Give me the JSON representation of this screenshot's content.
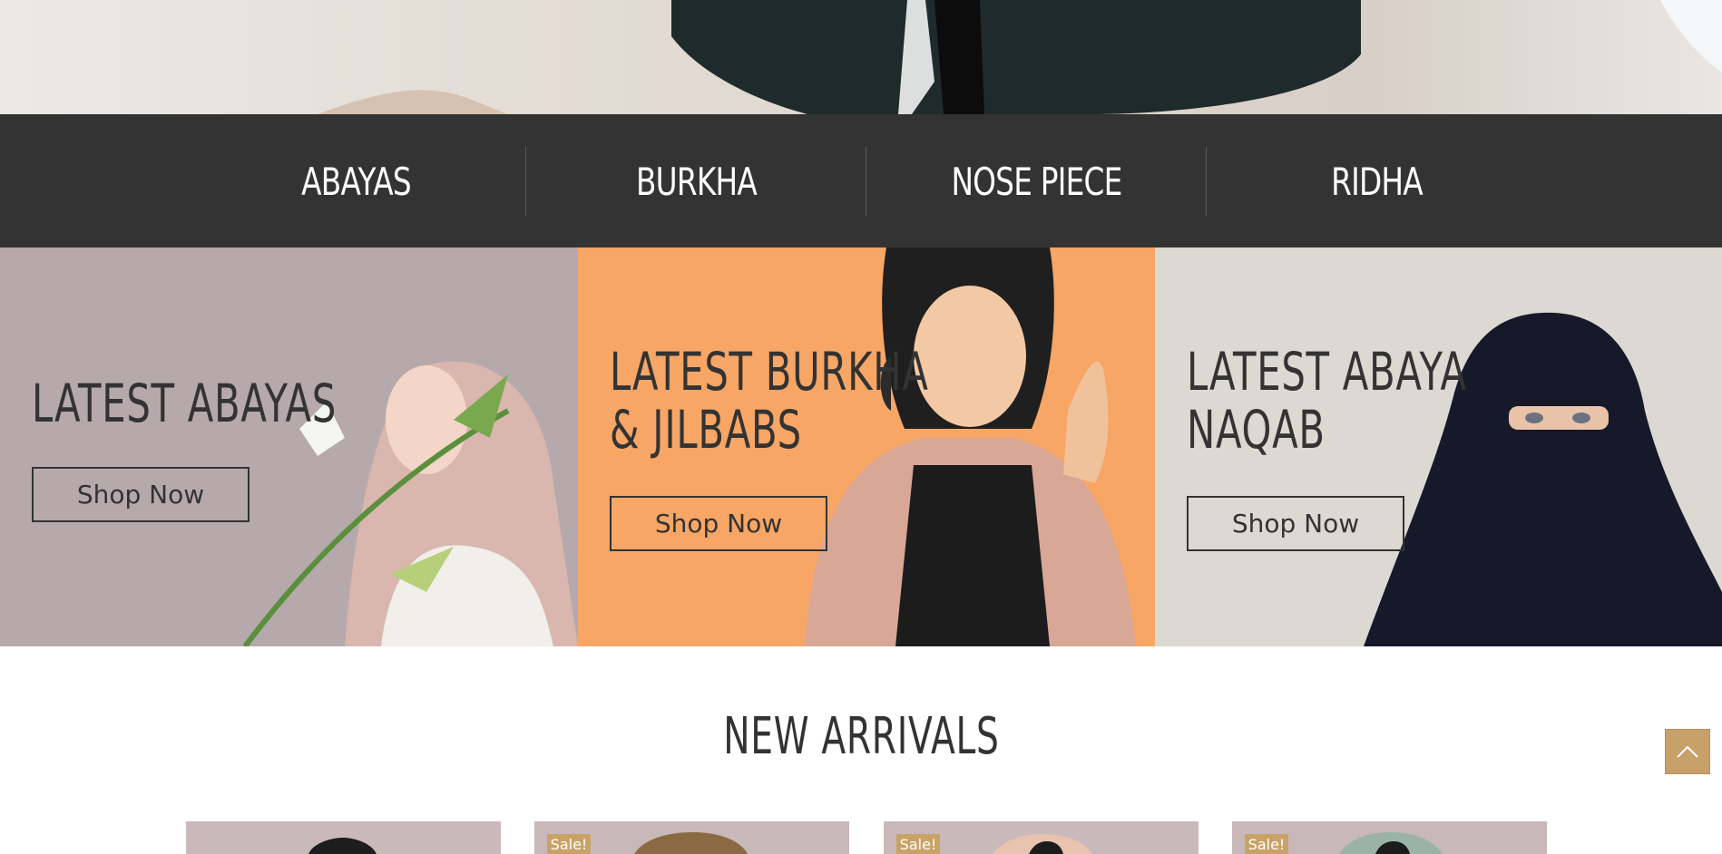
{
  "categories": [
    {
      "label": "ABAYAS"
    },
    {
      "label": "BURKHA"
    },
    {
      "label": "NOSE PIECE"
    },
    {
      "label": "RIDHA"
    }
  ],
  "banners": [
    {
      "title_line1": "LATEST ABAYAS",
      "title_line2": "",
      "button": "Shop Now",
      "bg": "#b6a9ab"
    },
    {
      "title_line1": "LATEST BURKHA",
      "title_line2": "& JILBABS",
      "button": "Shop Now",
      "bg": "#f7a565"
    },
    {
      "title_line1": "LATEST ABAYA",
      "title_line2": "NAQAB",
      "button": "Shop Now",
      "bg": "#dcd9d3"
    }
  ],
  "new_arrivals": {
    "title": "NEW ARRIVALS",
    "products": [
      {
        "sale": ""
      },
      {
        "sale": "Sale!"
      },
      {
        "sale": "Sale!"
      },
      {
        "sale": "Sale!"
      }
    ]
  },
  "colors": {
    "nav_bg": "#333333",
    "accent": "#c8a06a",
    "text_dark": "#333333"
  },
  "icons": {
    "scroll_top": "chevron-up-icon"
  }
}
